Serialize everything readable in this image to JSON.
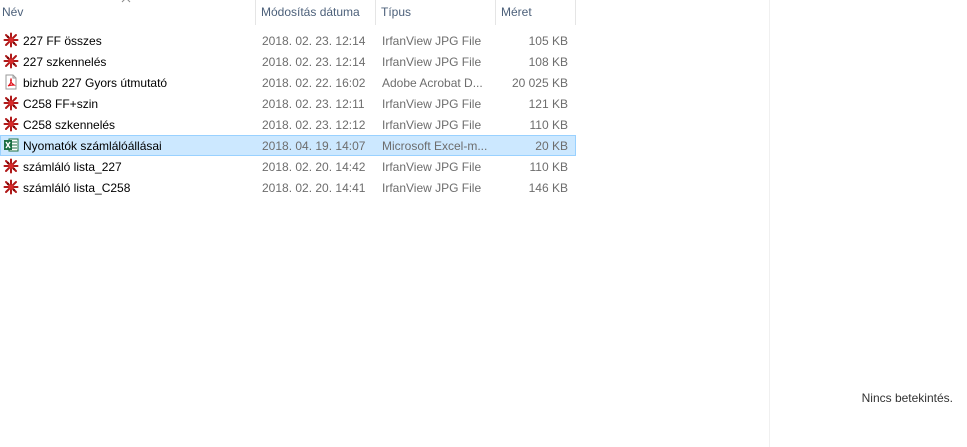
{
  "columns": {
    "name": "Név",
    "date": "Módosítás dátuma",
    "type": "Típus",
    "size": "Méret"
  },
  "files": [
    {
      "name": "227 FF összes",
      "date": "2018. 02. 23. 12:14",
      "type": "IrfanView JPG File",
      "size": "105 KB",
      "icon": "irfanview-jpg-icon"
    },
    {
      "name": "227 szkennelés",
      "date": "2018. 02. 23. 12:14",
      "type": "IrfanView JPG File",
      "size": "108 KB",
      "icon": "irfanview-jpg-icon"
    },
    {
      "name": "bizhub 227 Gyors útmutató",
      "date": "2018. 02. 22. 16:02",
      "type": "Adobe Acrobat D...",
      "size": "20 025 KB",
      "icon": "pdf-icon"
    },
    {
      "name": "C258 FF+szin",
      "date": "2018. 02. 23. 12:11",
      "type": "IrfanView JPG File",
      "size": "121 KB",
      "icon": "irfanview-jpg-icon"
    },
    {
      "name": "C258 szkennelés",
      "date": "2018. 02. 23. 12:12",
      "type": "IrfanView JPG File",
      "size": "110 KB",
      "icon": "irfanview-jpg-icon"
    },
    {
      "name": "Nyomatók számlálóállásai",
      "date": "2018. 04. 19. 14:07",
      "type": "Microsoft Excel-m...",
      "size": "20 KB",
      "icon": "excel-icon"
    },
    {
      "name": "számláló lista_227",
      "date": "2018. 02. 20. 14:42",
      "type": "IrfanView JPG File",
      "size": "110 KB",
      "icon": "irfanview-jpg-icon"
    },
    {
      "name": "számláló lista_C258",
      "date": "2018. 02. 20. 14:41",
      "type": "IrfanView JPG File",
      "size": "146 KB",
      "icon": "irfanview-jpg-icon"
    }
  ],
  "selected_file": "Nyomatók számlálóállásai",
  "preview": {
    "message": "Nincs betekintés."
  }
}
